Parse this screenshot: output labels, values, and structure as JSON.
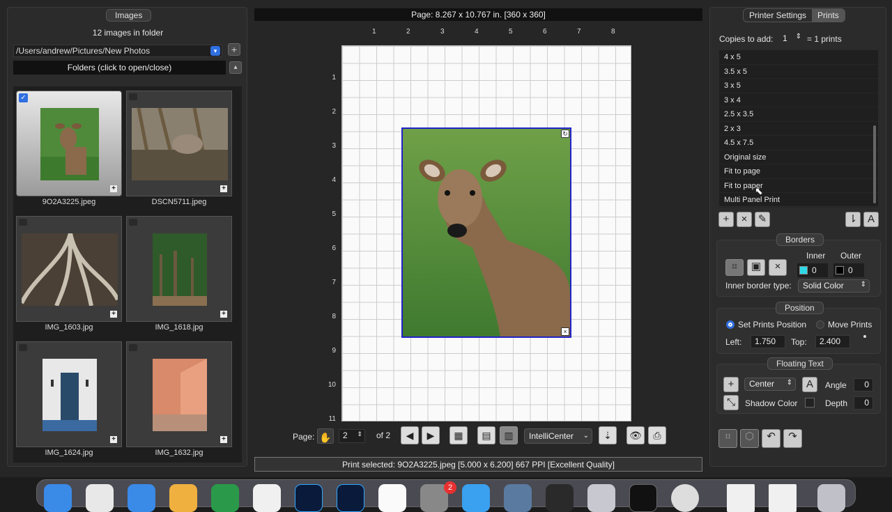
{
  "left_panel": {
    "title": "Images",
    "count_label": "12 images in folder",
    "path": "/Users/andrew/Pictures/New Photos",
    "folders_label": "Folders (click to open/close)",
    "images": [
      {
        "name": "9O2A3225.jpeg",
        "selected": true
      },
      {
        "name": "DSCN5711.jpeg",
        "selected": false
      },
      {
        "name": "IMG_1603.jpg",
        "selected": false
      },
      {
        "name": "IMG_1618.jpg",
        "selected": false
      },
      {
        "name": "IMG_1624.jpg",
        "selected": false
      },
      {
        "name": "IMG_1632.jpg",
        "selected": false
      }
    ]
  },
  "center": {
    "page_info": "Page: 8.267 x 10.767 in. [360 x 360]",
    "ruler_top": [
      "1",
      "2",
      "3",
      "4",
      "5",
      "6",
      "7",
      "8"
    ],
    "ruler_left": [
      "1",
      "2",
      "3",
      "4",
      "5",
      "6",
      "7",
      "8",
      "9",
      "10",
      "11"
    ],
    "page_label": "Page:",
    "page_value": "2",
    "page_of": "of 2",
    "intellicenter": "IntelliCenter",
    "status": "Print selected: 9O2A3225.jpeg [5.000 x 6.200] 667 PPI [Excellent Quality]"
  },
  "right_panel": {
    "tabs": [
      "Printer Settings",
      "Prints"
    ],
    "copies_label": "Copies to add:",
    "copies_value": "1",
    "copies_result": "= 1 prints",
    "sizes": [
      "4 x 5",
      "3.5 x 5",
      "3 x 5",
      "3 x 4",
      "2.5 x 3.5",
      "2 x 3",
      "4.5 x 7.5",
      "Original size",
      "Fit to page",
      "Fit to paper",
      "Multi Panel Print"
    ],
    "borders": {
      "title": "Borders",
      "inner_label": "Inner",
      "outer_label": "Outer",
      "inner_value": "0",
      "outer_value": "0",
      "inner_color": "#2fd8e6",
      "outer_color": "#000000",
      "type_label": "Inner border type:",
      "type_value": "Solid Color"
    },
    "position": {
      "title": "Position",
      "set_label": "Set Prints Position",
      "move_label": "Move Prints",
      "left_label": "Left:",
      "left_value": "1.750",
      "top_label": "Top:",
      "top_value": "2.400"
    },
    "floating_text": {
      "title": "Floating Text",
      "align": "Center",
      "angle_label": "Angle",
      "angle_value": "0",
      "shadow_label": "Shadow Color",
      "depth_label": "Depth",
      "depth_value": "0"
    }
  },
  "dock": {
    "badge": "2"
  }
}
